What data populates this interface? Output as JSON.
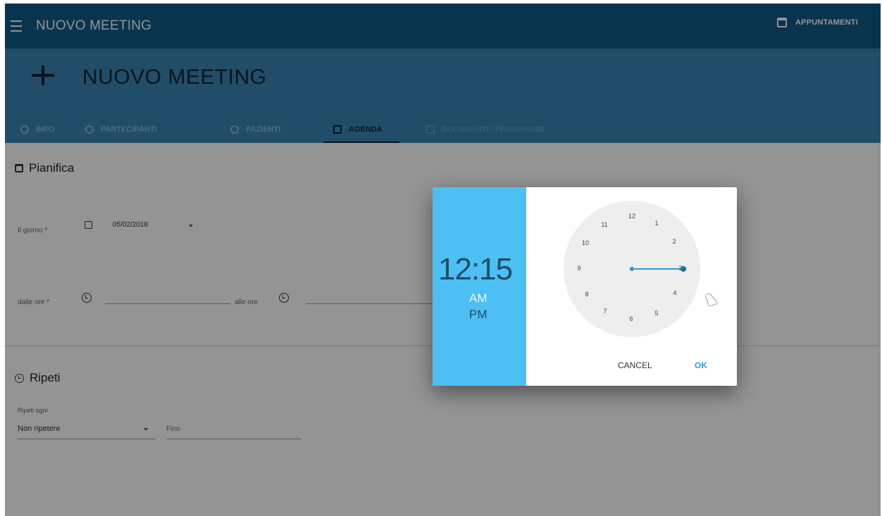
{
  "topbar": {
    "title": "NUOVO MEETING",
    "appointments_label": "APPUNTAMENTI"
  },
  "header": {
    "title": "NUOVO MEETING",
    "tabs": [
      {
        "label": "INFO",
        "icon": "info-icon"
      },
      {
        "label": "PARTECIPANTI",
        "icon": "people-icon"
      },
      {
        "label": "PAZIENTI",
        "icon": "people-icon"
      },
      {
        "label": "AGENDA",
        "icon": "calendar-icon",
        "active": true
      },
      {
        "label": "DOCUMENTI / PROGRAMMI",
        "icon": "folder-icon",
        "disabled": true
      }
    ]
  },
  "plan": {
    "section_title": "Pianifica",
    "day_label": "Il giorno *",
    "day_value": "05/02/2018",
    "from_label": "dalle ore *",
    "to_label": "alle ore"
  },
  "repeat": {
    "section_title": "Ripeti",
    "every_label": "Ripeti ogni",
    "every_value": "Non ripetere",
    "until_placeholder": "Fino"
  },
  "time_picker": {
    "time": "12:15",
    "am": "AM",
    "pm": "PM",
    "selected_period": "PM",
    "clock_numbers": [
      "12",
      "1",
      "2",
      "3",
      "4",
      "5",
      "6",
      "7",
      "8",
      "9",
      "10",
      "11"
    ],
    "cancel_label": "CANCEL",
    "ok_label": "OK"
  },
  "colors": {
    "topbar": "#0f5a86",
    "header": "#3a86b3",
    "picker_accent": "#4dbff3",
    "hand": "#2a9bd6"
  }
}
